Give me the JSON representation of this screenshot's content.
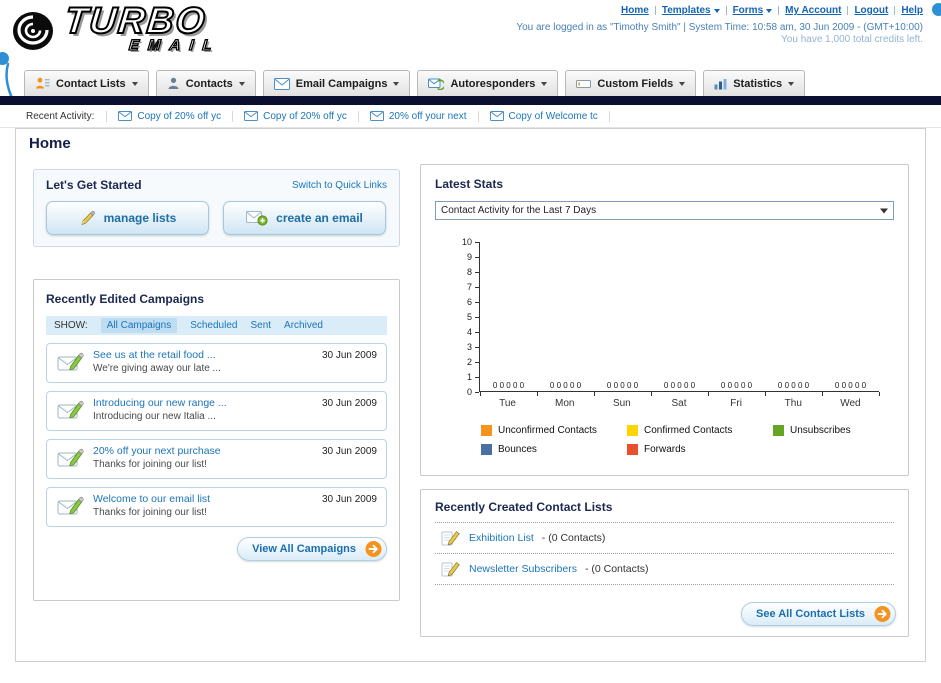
{
  "header": {
    "logo_title": "TURBO",
    "logo_subtitle": "EMAIL",
    "nav_links": [
      {
        "label": "Home",
        "dropdown": false
      },
      {
        "label": "Templates",
        "dropdown": true
      },
      {
        "label": "Forms",
        "dropdown": true
      },
      {
        "label": "My Account",
        "dropdown": false
      },
      {
        "label": "Logout",
        "dropdown": false
      },
      {
        "label": "Help",
        "dropdown": false
      }
    ],
    "login_status": "You are logged in as \"Timothy Smith\" | System Time: 10:58 am, 30 Jun 2009 - (GMT+10:00)",
    "credits": "You have 1,000 total credits left."
  },
  "main_nav": {
    "tabs": [
      {
        "label": "Contact Lists",
        "icon": "contact-lists-icon"
      },
      {
        "label": "Contacts",
        "icon": "contacts-icon"
      },
      {
        "label": "Email Campaigns",
        "icon": "email-campaigns-icon"
      },
      {
        "label": "Autoresponders",
        "icon": "autoresponders-icon"
      },
      {
        "label": "Custom Fields",
        "icon": "custom-fields-icon"
      },
      {
        "label": "Statistics",
        "icon": "statistics-icon"
      }
    ]
  },
  "recent_activity": {
    "label": "Recent Activity:",
    "item_icon": "envelope-icon",
    "items": [
      "Copy of 20% off yc",
      "Copy of 20% off yc",
      "20% off your next",
      "Copy of Welcome tc"
    ]
  },
  "page": {
    "title": "Home"
  },
  "get_started": {
    "title": "Let's Get Started",
    "switch_link": "Switch to Quick Links",
    "buttons": [
      {
        "label": "manage lists",
        "icon": "pencil-icon"
      },
      {
        "label": "create an email",
        "icon": "envelope-plus-icon"
      }
    ]
  },
  "campaigns": {
    "title": "Recently Edited Campaigns",
    "show_label": "SHOW:",
    "item_icon": "envelope-pencil-icon",
    "filters": [
      {
        "label": "All Campaigns",
        "active": true
      },
      {
        "label": "Scheduled",
        "active": false
      },
      {
        "label": "Sent",
        "active": false
      },
      {
        "label": "Archived",
        "active": false
      }
    ],
    "items": [
      {
        "title": "See us at the retail food ...",
        "subtitle": "We're giving away our late ...",
        "date": "30 Jun 2009"
      },
      {
        "title": "Introducing our new range ...",
        "subtitle": "Introducing our new Italia ...",
        "date": "30 Jun 2009"
      },
      {
        "title": "20% off your next purchase",
        "subtitle": "Thanks for joining our list!",
        "date": "30 Jun 2009"
      },
      {
        "title": "Welcome to our email list",
        "subtitle": "Thanks for joining our list!",
        "date": "30 Jun 2009"
      }
    ],
    "view_all_label": "View All Campaigns",
    "arrow_icon": "arrow-circle-icon"
  },
  "stats": {
    "title": "Latest Stats",
    "selected_option": "Contact Activity for the Last 7 Days"
  },
  "chart_data": {
    "type": "bar",
    "title": "Contact Activity for the Last 7 Days",
    "categories": [
      "Tue",
      "Mon",
      "Sun",
      "Sat",
      "Fri",
      "Thu",
      "Wed"
    ],
    "series": [
      {
        "name": "Unconfirmed Contacts",
        "color": "#f6921e",
        "values": [
          0,
          0,
          0,
          0,
          0,
          0,
          0
        ]
      },
      {
        "name": "Confirmed Contacts",
        "color": "#ffd400",
        "values": [
          0,
          0,
          0,
          0,
          0,
          0,
          0
        ]
      },
      {
        "name": "Unsubscribes",
        "color": "#66a523",
        "values": [
          0,
          0,
          0,
          0,
          0,
          0,
          0
        ]
      },
      {
        "name": "Bounces",
        "color": "#4a6fa5",
        "values": [
          0,
          0,
          0,
          0,
          0,
          0,
          0
        ]
      },
      {
        "name": "Forwards",
        "color": "#e8512e",
        "values": [
          0,
          0,
          0,
          0,
          0,
          0,
          0
        ]
      }
    ],
    "ylim": [
      0,
      10
    ],
    "yticks": [
      10,
      9,
      8,
      7,
      6,
      5,
      4,
      3,
      2,
      1,
      0
    ],
    "grid": false,
    "legend_position": "bottom"
  },
  "contact_lists": {
    "title": "Recently Created Contact Lists",
    "item_icon": "pencil-note-icon",
    "items": [
      {
        "name": "Exhibition List",
        "detail": " - (0 Contacts)"
      },
      {
        "name": "Newsletter Subscribers",
        "detail": " - (0 Contacts)"
      }
    ],
    "see_all_label": "See All Contact Lists",
    "arrow_icon": "arrow-circle-icon"
  }
}
